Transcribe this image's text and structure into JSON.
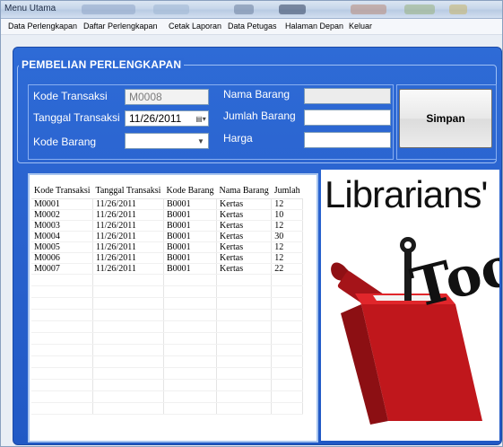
{
  "window": {
    "title": "Menu Utama"
  },
  "menu": [
    "Data Perlengkapan",
    "Daftar Perlengkapan",
    "Cetak Laporan",
    "Data Petugas",
    "Halaman Depan",
    "Keluar"
  ],
  "form": {
    "group_title": "PEMBELIAN PERLENGKAPAN",
    "kode_transaksi_label": "Kode Transaksi",
    "kode_transaksi_value": "M0008",
    "tanggal_transaksi_label": "Tanggal Transaksi",
    "tanggal_transaksi_value": "11/26/2011",
    "kode_barang_label": "Kode Barang",
    "kode_barang_value": "",
    "nama_barang_label": "Nama Barang",
    "nama_barang_value": "",
    "jumlah_barang_label": "Jumlah Barang",
    "jumlah_barang_value": "",
    "harga_label": "Harga",
    "harga_value": "",
    "simpan_label": "Simpan"
  },
  "grid": {
    "columns": [
      "Kode Transaksi",
      "Tanggal Transaksi",
      "Kode Barang",
      "Nama Barang",
      "Jumlah"
    ],
    "rows": [
      [
        "M0001",
        "11/26/2011",
        "B0001",
        "Kertas",
        "12"
      ],
      [
        "M0002",
        "11/26/2011",
        "B0001",
        "Kertas",
        "10"
      ],
      [
        "M0003",
        "11/26/2011",
        "B0001",
        "Kertas",
        "12"
      ],
      [
        "M0004",
        "11/26/2011",
        "B0001",
        "Kertas",
        "30"
      ],
      [
        "M0005",
        "11/26/2011",
        "B0001",
        "Kertas",
        "12"
      ],
      [
        "M0006",
        "11/26/2011",
        "B0001",
        "Kertas",
        "12"
      ],
      [
        "M0007",
        "11/26/2011",
        "B0001",
        "Kertas",
        "22"
      ]
    ]
  },
  "logo": {
    "line1": "Librarians'",
    "line2": "Tools",
    "icon": "toolbox-icon",
    "box_color": "#c0171c"
  }
}
